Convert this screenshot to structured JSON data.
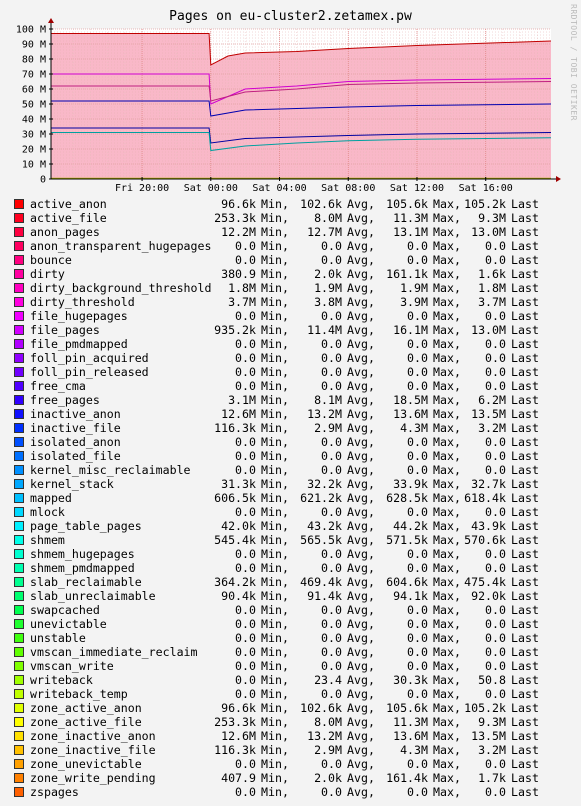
{
  "title": "Pages on eu-cluster2.zetamex.pw",
  "watermark": "RRDTOOL / TOBI OETIKER",
  "chart_data": {
    "type": "area",
    "title": "Pages on eu-cluster2.zetamex.pw",
    "xlabel": "",
    "ylabel": "",
    "ylim": [
      0,
      100000000
    ],
    "yticks": [
      {
        "value": 0,
        "label": "0"
      },
      {
        "value": 10000000,
        "label": "10 M"
      },
      {
        "value": 20000000,
        "label": "20 M"
      },
      {
        "value": 30000000,
        "label": "30 M"
      },
      {
        "value": 40000000,
        "label": "40 M"
      },
      {
        "value": 50000000,
        "label": "50 M"
      },
      {
        "value": 60000000,
        "label": "60 M"
      },
      {
        "value": 70000000,
        "label": "70 M"
      },
      {
        "value": 80000000,
        "label": "80 M"
      },
      {
        "value": 90000000,
        "label": "90 M"
      },
      {
        "value": 100000000,
        "label": "100 M"
      }
    ],
    "xlim_hours": [
      -5.3,
      23.8
    ],
    "xticks": [
      {
        "hour": 0,
        "label": "Fri 20:00"
      },
      {
        "hour": 4,
        "label": "Sat 00:00"
      },
      {
        "hour": 8,
        "label": "Sat 04:00"
      },
      {
        "hour": 12,
        "label": "Sat 08:00"
      },
      {
        "hour": 16,
        "label": "Sat 12:00"
      },
      {
        "hour": 20,
        "label": "Sat 16:00"
      }
    ],
    "grid": true,
    "bands": [
      {
        "name": "yellow",
        "color": "#f9f9a4",
        "points": [
          [
            -5.3,
            29
          ],
          [
            3.9,
            29
          ],
          [
            4.0,
            16
          ],
          [
            6,
            20
          ],
          [
            9,
            22
          ],
          [
            12,
            24
          ],
          [
            16,
            25
          ],
          [
            23.8,
            26
          ]
        ]
      },
      {
        "name": "cyan",
        "color": "#5ff0f0",
        "points": [
          [
            -5.3,
            31
          ],
          [
            3.9,
            31
          ],
          [
            4.0,
            19
          ],
          [
            6,
            22
          ],
          [
            9,
            24
          ],
          [
            12,
            25.5
          ],
          [
            16,
            26.5
          ],
          [
            23.8,
            27.5
          ]
        ]
      },
      {
        "name": "blue",
        "color": "#a8a8ff",
        "points": [
          [
            -5.3,
            53
          ],
          [
            3.9,
            53
          ],
          [
            4.0,
            43
          ],
          [
            6,
            47
          ],
          [
            9,
            48
          ],
          [
            12,
            50
          ],
          [
            16,
            51
          ],
          [
            23.8,
            52
          ]
        ]
      },
      {
        "name": "magenta",
        "color": "#f0a0f0",
        "points": [
          [
            -5.3,
            70
          ],
          [
            3.9,
            70
          ],
          [
            4.0,
            50
          ],
          [
            6,
            60
          ],
          [
            9,
            62
          ],
          [
            12,
            65
          ],
          [
            16,
            66
          ],
          [
            23.8,
            67
          ]
        ]
      },
      {
        "name": "pink",
        "color": "#f9b8c8",
        "points": [
          [
            -5.3,
            97
          ],
          [
            3.9,
            97
          ],
          [
            4.0,
            76
          ],
          [
            5,
            82
          ],
          [
            6,
            84
          ],
          [
            9,
            85
          ],
          [
            12,
            87
          ],
          [
            16,
            89
          ],
          [
            23.8,
            92
          ]
        ]
      }
    ],
    "lines": [
      {
        "color": "#c00000",
        "points": [
          [
            -5.3,
            97
          ],
          [
            3.9,
            97
          ],
          [
            4.0,
            76
          ],
          [
            5,
            82
          ],
          [
            6,
            84
          ],
          [
            9,
            85
          ],
          [
            12,
            87
          ],
          [
            16,
            89
          ],
          [
            23.8,
            92
          ]
        ]
      },
      {
        "color": "#d000d0",
        "points": [
          [
            -5.3,
            70
          ],
          [
            3.9,
            70
          ],
          [
            4.0,
            50
          ],
          [
            6,
            60
          ],
          [
            9,
            62
          ],
          [
            12,
            65
          ],
          [
            16,
            66
          ],
          [
            23.8,
            67
          ]
        ]
      },
      {
        "color": "#c02080",
        "points": [
          [
            -5.3,
            62
          ],
          [
            3.9,
            62
          ],
          [
            4.0,
            52
          ],
          [
            6,
            58
          ],
          [
            9,
            60
          ],
          [
            12,
            63
          ],
          [
            16,
            64
          ],
          [
            23.8,
            65
          ]
        ]
      },
      {
        "color": "#0000b0",
        "points": [
          [
            -5.3,
            52
          ],
          [
            3.9,
            52
          ],
          [
            4.0,
            42
          ],
          [
            6,
            46
          ],
          [
            9,
            47
          ],
          [
            12,
            48
          ],
          [
            16,
            49
          ],
          [
            23.8,
            50
          ]
        ]
      },
      {
        "color": "#0000a0",
        "points": [
          [
            -5.3,
            34
          ],
          [
            3.9,
            34
          ],
          [
            4.0,
            24
          ],
          [
            6,
            27
          ],
          [
            9,
            28
          ],
          [
            12,
            29
          ],
          [
            16,
            30
          ],
          [
            23.8,
            31
          ]
        ]
      },
      {
        "color": "#00a0a0",
        "points": [
          [
            -5.3,
            31
          ],
          [
            3.9,
            31
          ],
          [
            4.0,
            19
          ],
          [
            6,
            22
          ],
          [
            9,
            24
          ],
          [
            12,
            25.5
          ],
          [
            16,
            26.5
          ],
          [
            23.8,
            27.5
          ]
        ]
      },
      {
        "color": "#b0b000",
        "points": [
          [
            -5.3,
            0.5
          ],
          [
            3.9,
            0.5
          ],
          [
            4.0,
            0.5
          ],
          [
            23.8,
            0.5
          ]
        ]
      }
    ],
    "legend_columns": [
      "Min,",
      "Avg,",
      "Max,",
      "Last"
    ],
    "series": [
      {
        "name": "active_anon",
        "color": "#ff0000",
        "min": "96.6k",
        "avg": "102.6k",
        "max": "105.6k",
        "last": "105.2k"
      },
      {
        "name": "active_file",
        "color": "#ff0020",
        "min": "253.3k",
        "avg": "8.0M",
        "max": "11.3M",
        "last": "9.3M"
      },
      {
        "name": "anon_pages",
        "color": "#ff0040",
        "min": "12.2M",
        "avg": "12.7M",
        "max": "13.1M",
        "last": "13.0M"
      },
      {
        "name": "anon_transparent_hugepages",
        "color": "#ff0060",
        "min": "0.0",
        "avg": "0.0",
        "max": "0.0",
        "last": "0.0"
      },
      {
        "name": "bounce",
        "color": "#ff0080",
        "min": "0.0",
        "avg": "0.0",
        "max": "0.0",
        "last": "0.0"
      },
      {
        "name": "dirty",
        "color": "#ff00a0",
        "min": "380.9",
        "avg": "2.0k",
        "max": "161.1k",
        "last": "1.6k"
      },
      {
        "name": "dirty_background_threshold",
        "color": "#ff00c0",
        "min": "1.8M",
        "avg": "1.9M",
        "max": "1.9M",
        "last": "1.8M"
      },
      {
        "name": "dirty_threshold",
        "color": "#ff00e0",
        "min": "3.7M",
        "avg": "3.8M",
        "max": "3.9M",
        "last": "3.7M"
      },
      {
        "name": "file_hugepages",
        "color": "#f000ff",
        "min": "0.0",
        "avg": "0.0",
        "max": "0.0",
        "last": "0.0"
      },
      {
        "name": "file_pages",
        "color": "#d000ff",
        "min": "935.2k",
        "avg": "11.4M",
        "max": "16.1M",
        "last": "13.0M"
      },
      {
        "name": "file_pmdmapped",
        "color": "#b000ff",
        "min": "0.0",
        "avg": "0.0",
        "max": "0.0",
        "last": "0.0"
      },
      {
        "name": "foll_pin_acquired",
        "color": "#9000ff",
        "min": "0.0",
        "avg": "0.0",
        "max": "0.0",
        "last": "0.0"
      },
      {
        "name": "foll_pin_released",
        "color": "#7000ff",
        "min": "0.0",
        "avg": "0.0",
        "max": "0.0",
        "last": "0.0"
      },
      {
        "name": "free_cma",
        "color": "#5000ff",
        "min": "0.0",
        "avg": "0.0",
        "max": "0.0",
        "last": "0.0"
      },
      {
        "name": "free_pages",
        "color": "#3000ff",
        "min": "3.1M",
        "avg": "8.1M",
        "max": "18.5M",
        "last": "6.2M"
      },
      {
        "name": "inactive_anon",
        "color": "#1010ff",
        "min": "12.6M",
        "avg": "13.2M",
        "max": "13.6M",
        "last": "13.5M"
      },
      {
        "name": "inactive_file",
        "color": "#0030ff",
        "min": "116.3k",
        "avg": "2.9M",
        "max": "4.3M",
        "last": "3.2M"
      },
      {
        "name": "isolated_anon",
        "color": "#0050ff",
        "min": "0.0",
        "avg": "0.0",
        "max": "0.0",
        "last": "0.0"
      },
      {
        "name": "isolated_file",
        "color": "#0070ff",
        "min": "0.0",
        "avg": "0.0",
        "max": "0.0",
        "last": "0.0"
      },
      {
        "name": "kernel_misc_reclaimable",
        "color": "#0090ff",
        "min": "0.0",
        "avg": "0.0",
        "max": "0.0",
        "last": "0.0"
      },
      {
        "name": "kernel_stack",
        "color": "#00a8ff",
        "min": "31.3k",
        "avg": "32.2k",
        "max": "33.9k",
        "last": "32.7k"
      },
      {
        "name": "mapped",
        "color": "#00c0ff",
        "min": "606.5k",
        "avg": "621.2k",
        "max": "628.5k",
        "last": "618.4k"
      },
      {
        "name": "mlock",
        "color": "#00d8ff",
        "min": "0.0",
        "avg": "0.0",
        "max": "0.0",
        "last": "0.0"
      },
      {
        "name": "page_table_pages",
        "color": "#00f0ff",
        "min": "42.0k",
        "avg": "43.2k",
        "max": "44.2k",
        "last": "43.9k"
      },
      {
        "name": "shmem",
        "color": "#00ffe8",
        "min": "545.4k",
        "avg": "565.5k",
        "max": "571.5k",
        "last": "570.6k"
      },
      {
        "name": "shmem_hugepages",
        "color": "#00ffd0",
        "min": "0.0",
        "avg": "0.0",
        "max": "0.0",
        "last": "0.0"
      },
      {
        "name": "shmem_pmdmapped",
        "color": "#00ffb0",
        "min": "0.0",
        "avg": "0.0",
        "max": "0.0",
        "last": "0.0"
      },
      {
        "name": "slab_reclaimable",
        "color": "#00ff90",
        "min": "364.2k",
        "avg": "469.4k",
        "max": "604.6k",
        "last": "475.4k"
      },
      {
        "name": "slab_unreclaimable",
        "color": "#00ff70",
        "min": "90.4k",
        "avg": "91.4k",
        "max": "94.1k",
        "last": "92.0k"
      },
      {
        "name": "swapcached",
        "color": "#00ff50",
        "min": "0.0",
        "avg": "0.0",
        "max": "0.0",
        "last": "0.0"
      },
      {
        "name": "unevictable",
        "color": "#20ff30",
        "min": "0.0",
        "avg": "0.0",
        "max": "0.0",
        "last": "0.0"
      },
      {
        "name": "unstable",
        "color": "#40ff10",
        "min": "0.0",
        "avg": "0.0",
        "max": "0.0",
        "last": "0.0"
      },
      {
        "name": "vmscan_immediate_reclaim",
        "color": "#60ff00",
        "min": "0.0",
        "avg": "0.0",
        "max": "0.0",
        "last": "0.0"
      },
      {
        "name": "vmscan_write",
        "color": "#80ff00",
        "min": "0.0",
        "avg": "0.0",
        "max": "0.0",
        "last": "0.0"
      },
      {
        "name": "writeback",
        "color": "#a0ff00",
        "min": "0.0",
        "avg": "23.4",
        "max": "30.3k",
        "last": "50.8"
      },
      {
        "name": "writeback_temp",
        "color": "#c0ff00",
        "min": "0.0",
        "avg": "0.0",
        "max": "0.0",
        "last": "0.0"
      },
      {
        "name": "zone_active_anon",
        "color": "#e0ff00",
        "min": "96.6k",
        "avg": "102.6k",
        "max": "105.6k",
        "last": "105.2k"
      },
      {
        "name": "zone_active_file",
        "color": "#ffff00",
        "min": "253.3k",
        "avg": "8.0M",
        "max": "11.3M",
        "last": "9.3M"
      },
      {
        "name": "zone_inactive_anon",
        "color": "#ffe000",
        "min": "12.6M",
        "avg": "13.2M",
        "max": "13.6M",
        "last": "13.5M"
      },
      {
        "name": "zone_inactive_file",
        "color": "#ffc000",
        "min": "116.3k",
        "avg": "2.9M",
        "max": "4.3M",
        "last": "3.2M"
      },
      {
        "name": "zone_unevictable",
        "color": "#ffa000",
        "min": "0.0",
        "avg": "0.0",
        "max": "0.0",
        "last": "0.0"
      },
      {
        "name": "zone_write_pending",
        "color": "#ff8000",
        "min": "407.9",
        "avg": "2.0k",
        "max": "161.4k",
        "last": "1.7k"
      },
      {
        "name": "zspages",
        "color": "#ff6000",
        "min": "0.0",
        "avg": "0.0",
        "max": "0.0",
        "last": "0.0"
      }
    ]
  }
}
